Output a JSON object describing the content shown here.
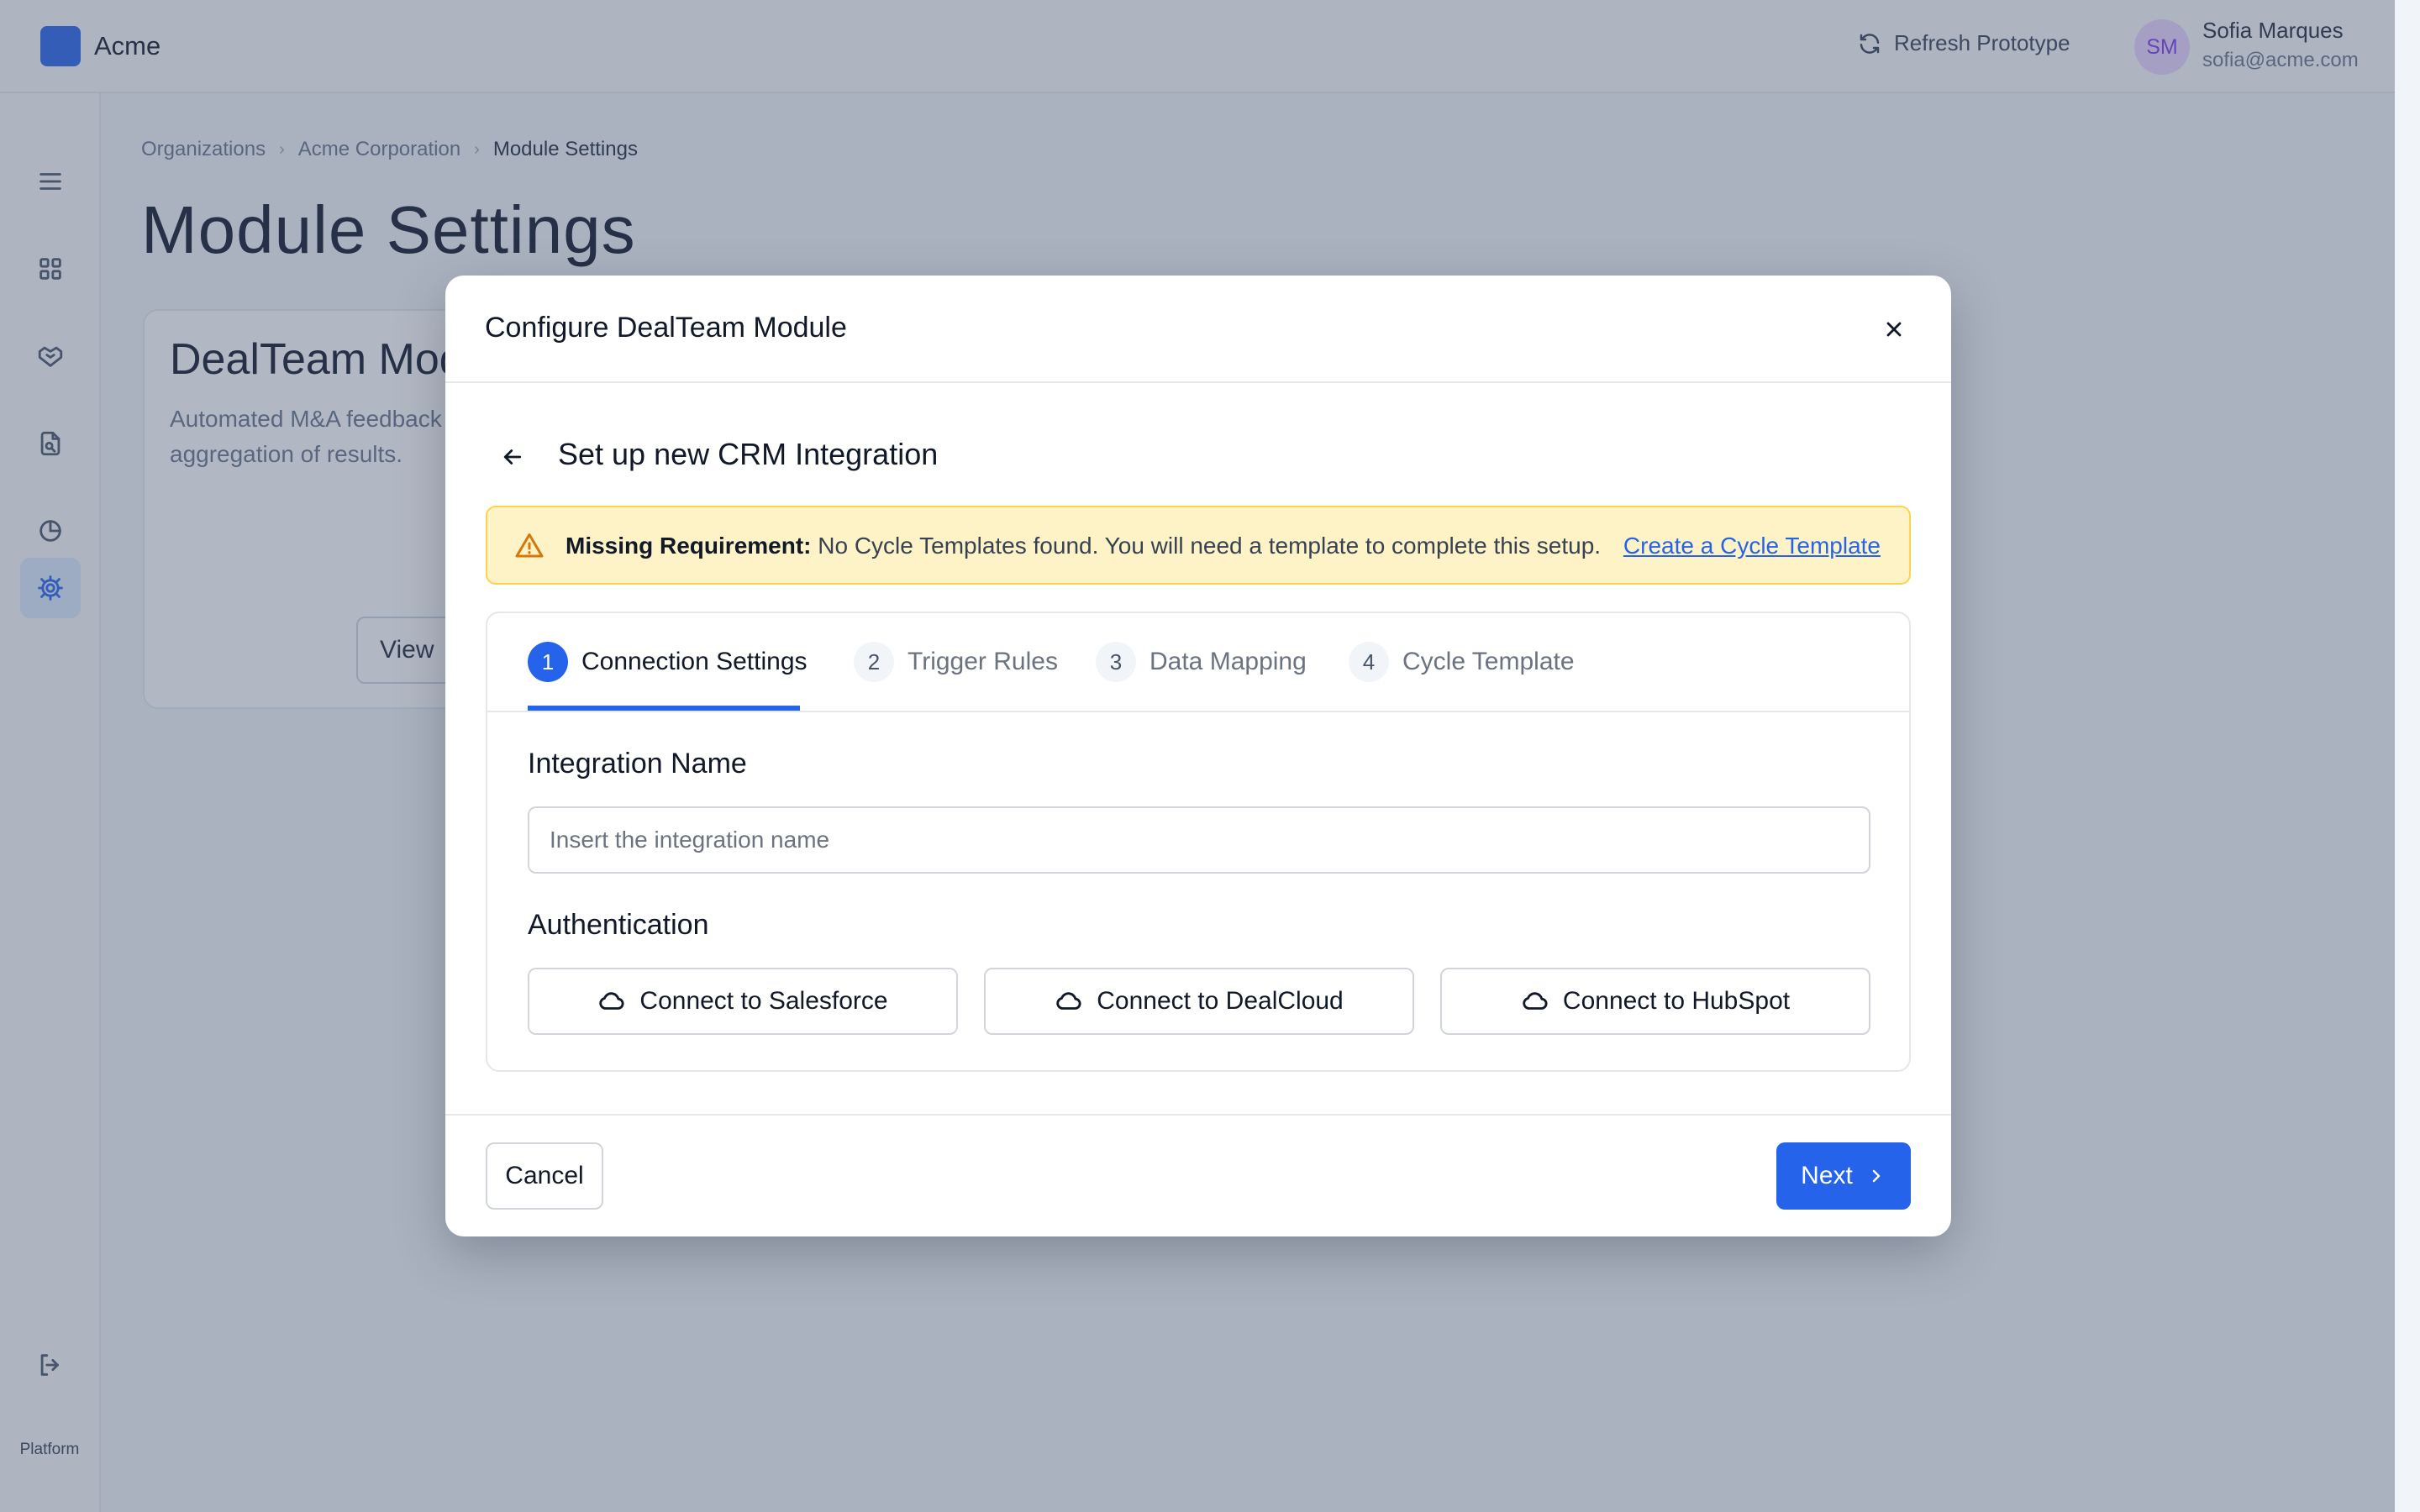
{
  "header": {
    "brand_name": "Acme",
    "refresh_label": "Refresh Prototype",
    "user": {
      "initials": "SM",
      "name": "Sofia Marques",
      "email": "sofia@acme.com"
    }
  },
  "sidebar": {
    "items": [
      {
        "icon": "menu-icon"
      },
      {
        "icon": "dashboard-icon"
      },
      {
        "icon": "handshake-icon"
      },
      {
        "icon": "document-search-icon"
      },
      {
        "icon": "pie-chart-icon"
      },
      {
        "icon": "gear-icon",
        "active": true
      }
    ],
    "logout_icon": "logout-icon",
    "footer_label": "Platform"
  },
  "breadcrumb": [
    "Organizations",
    "Acme Corporation",
    "Module Settings"
  ],
  "page_title": "Module Settings",
  "module_card": {
    "title": "DealTeam Module",
    "description": "Automated M&A feedback cycles with CRM integrations, and aggregation of results.",
    "view_label": "View"
  },
  "modal": {
    "title": "Configure DealTeam Module",
    "section_title": "Set up new CRM Integration",
    "alert": {
      "label": "Missing Requirement:",
      "message": "No Cycle Templates found. You will need a template to complete this setup.",
      "link": "Create a Cycle Template"
    },
    "steps": [
      {
        "number": "1",
        "label": "Connection Settings",
        "active": true
      },
      {
        "number": "2",
        "label": "Trigger Rules"
      },
      {
        "number": "3",
        "label": "Data Mapping"
      },
      {
        "number": "4",
        "label": "Cycle Template"
      }
    ],
    "integration_name": {
      "label": "Integration Name",
      "placeholder": "Insert the integration name",
      "value": ""
    },
    "authentication": {
      "label": "Authentication",
      "buttons": [
        "Connect to Salesforce",
        "Connect to DealCloud",
        "Connect to HubSpot"
      ]
    },
    "cancel_label": "Cancel",
    "next_label": "Next"
  },
  "colors": {
    "primary": "#2563eb",
    "warning_bg": "#fef3c7",
    "warning_border": "#fcd34d",
    "avatar_bg": "#e9d5ff"
  }
}
